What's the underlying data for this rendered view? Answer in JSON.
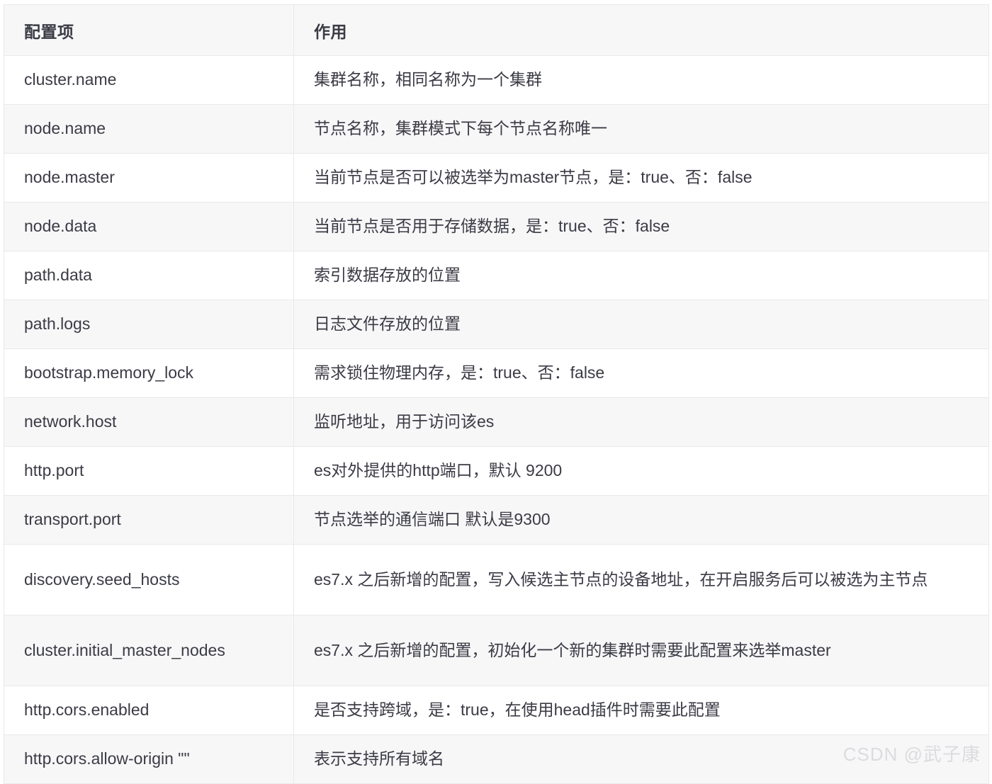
{
  "table": {
    "headers": {
      "key": "配置项",
      "desc": "作用"
    },
    "rows": [
      {
        "key": "cluster.name",
        "desc": "集群名称，相同名称为一个集群"
      },
      {
        "key": "node.name",
        "desc": "节点名称，集群模式下每个节点名称唯一"
      },
      {
        "key": "node.master",
        "desc": "当前节点是否可以被选举为master节点，是：true、否：false"
      },
      {
        "key": "node.data",
        "desc": "当前节点是否用于存储数据，是：true、否：false"
      },
      {
        "key": "path.data",
        "desc": "索引数据存放的位置"
      },
      {
        "key": "path.logs",
        "desc": "日志文件存放的位置"
      },
      {
        "key": "bootstrap.memory_lock",
        "desc": "需求锁住物理内存，是：true、否：false"
      },
      {
        "key": "network.host",
        "desc": "监听地址，用于访问该es"
      },
      {
        "key": "http.port",
        "desc": "es对外提供的http端口，默认 9200"
      },
      {
        "key": "transport.port",
        "desc": "节点选举的通信端口 默认是9300"
      },
      {
        "key": "discovery.seed_hosts",
        "desc": "es7.x 之后新增的配置，写入候选主节点的设备地址，在开启服务后可以被选为主节点"
      },
      {
        "key": "cluster.initial_master_nodes",
        "desc": "es7.x 之后新增的配置，初始化一个新的集群时需要此配置来选举master"
      },
      {
        "key": "http.cors.enabled",
        "desc": "是否支持跨域，是：true，在使用head插件时需要此配置"
      },
      {
        "key": "http.cors.allow-origin \"\"",
        "desc": "表示支持所有域名"
      }
    ]
  },
  "watermark": {
    "text": "CSDN @武子康"
  },
  "colors": {
    "header_background": "#f7f7f8",
    "row_alt_background": "#f7f7f8",
    "row_background": "#ffffff",
    "border": "#e9e9ec",
    "text": "#3b3b45",
    "watermark": "#dcdce0"
  }
}
